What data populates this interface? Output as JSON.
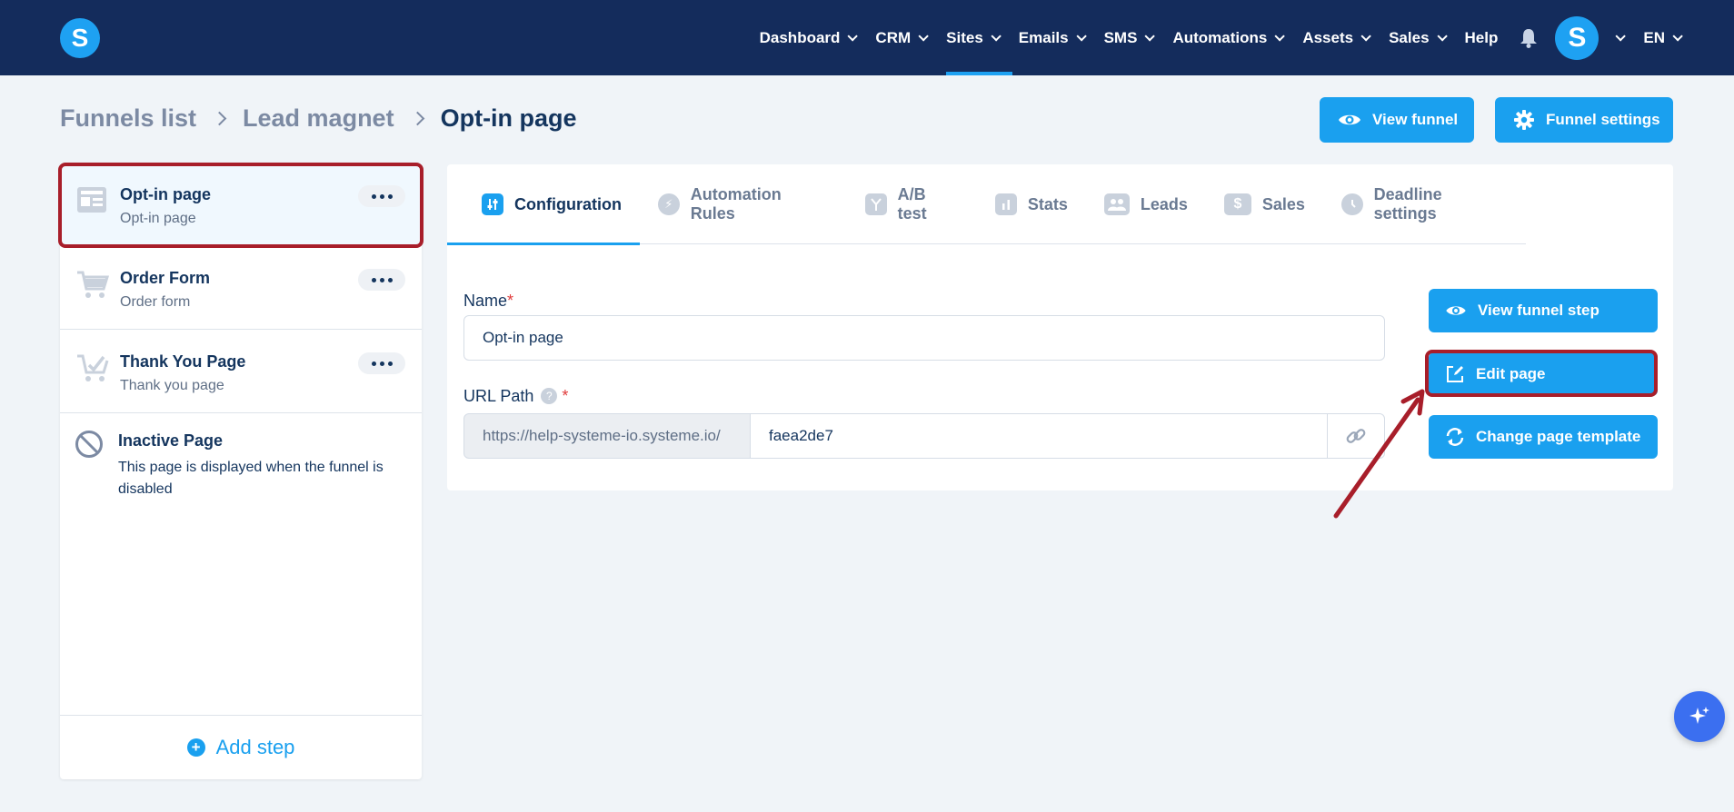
{
  "topnav": {
    "logo": "S",
    "items": [
      {
        "label": "Dashboard",
        "chevron": true
      },
      {
        "label": "CRM",
        "chevron": true
      },
      {
        "label": "Sites",
        "chevron": true
      },
      {
        "label": "Emails",
        "chevron": true
      },
      {
        "label": "SMS",
        "chevron": true
      },
      {
        "label": "Automations",
        "chevron": true
      },
      {
        "label": "Assets",
        "chevron": true
      },
      {
        "label": "Sales",
        "chevron": true
      },
      {
        "label": "Help",
        "chevron": false
      }
    ],
    "active_item": "Sites",
    "avatar": "S",
    "language": "EN"
  },
  "breadcrumb": {
    "items": [
      "Funnels list",
      "Lead magnet"
    ],
    "current": "Opt-in page"
  },
  "header_buttons": {
    "view_funnel": "View funnel",
    "funnel_settings": "Funnel settings"
  },
  "steps": [
    {
      "title": "Opt-in page",
      "subtitle": "Opt-in page",
      "icon": "page-layout-icon"
    },
    {
      "title": "Order Form",
      "subtitle": "Order form",
      "icon": "cart-icon"
    },
    {
      "title": "Thank You Page",
      "subtitle": "Thank you page",
      "icon": "cart-check-icon"
    }
  ],
  "inactive_step": {
    "title": "Inactive Page",
    "description": "This page is displayed when the funnel is disabled",
    "icon": "ban-icon"
  },
  "add_step": "Add step",
  "tabs": [
    {
      "label": "Configuration",
      "icon": "sliders-icon"
    },
    {
      "label": "Automation Rules",
      "icon": "bolt-icon"
    },
    {
      "label": "A/B test",
      "icon": "split-icon"
    },
    {
      "label": "Stats",
      "icon": "bar-chart-icon"
    },
    {
      "label": "Leads",
      "icon": "users-icon"
    },
    {
      "label": "Sales",
      "icon": "dollar-icon"
    },
    {
      "label": "Deadline settings",
      "icon": "clock-icon"
    }
  ],
  "active_tab": "Configuration",
  "form": {
    "name_label": "Name",
    "name_value": "Opt-in page",
    "url_label": "URL Path",
    "url_prefix": "https://help-systeme-io.systeme.io/",
    "url_value": "faea2de7",
    "required_mark": "*",
    "help_mark": "?"
  },
  "actions": {
    "view_step": "View funnel step",
    "edit_page": "Edit page",
    "change_template": "Change page template"
  },
  "colors": {
    "nav_bg": "#142c5c",
    "accent": "#1aa0ef",
    "highlight": "#a81e2a"
  }
}
